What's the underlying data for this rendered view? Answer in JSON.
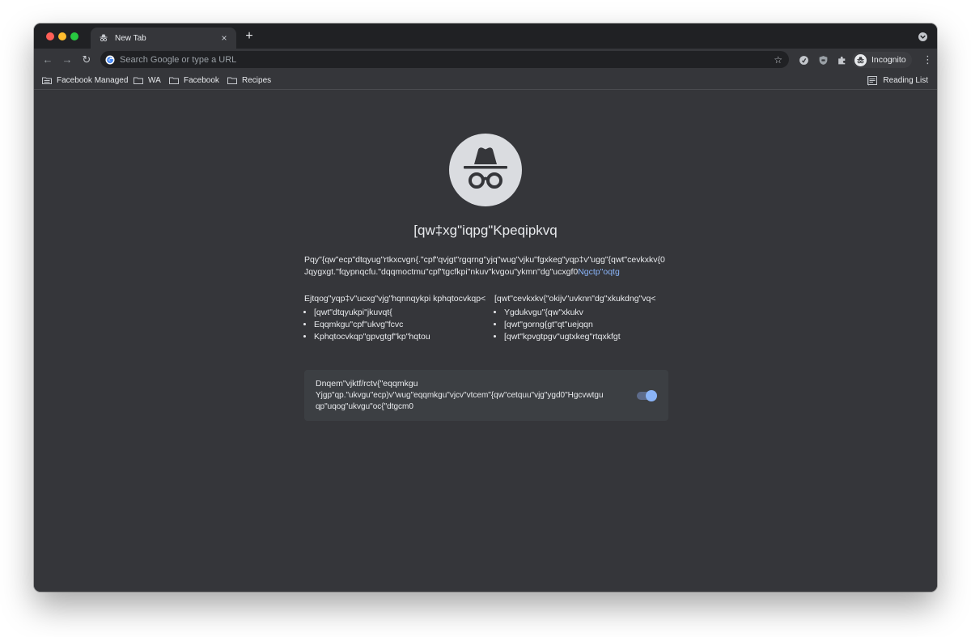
{
  "tab": {
    "title": "New Tab",
    "close": "×",
    "new_tab": "+"
  },
  "toolbar": {
    "back": "←",
    "forward": "→",
    "reload": "↻",
    "omnibox_placeholder": "Search Google or type a URL",
    "star": "☆",
    "profile_label": "Incognito",
    "menu": "⋮"
  },
  "bookmarks": {
    "items": [
      {
        "label": "Facebook Managed",
        "icon": "managed-folder-icon"
      },
      {
        "label": "WA",
        "icon": "folder-icon"
      },
      {
        "label": "Facebook",
        "icon": "folder-icon"
      },
      {
        "label": "Recipes",
        "icon": "folder-icon"
      }
    ],
    "reading_list": "Reading List"
  },
  "incognito": {
    "title": "[qw‡xg\"iqpg\"Kpeqipkvq",
    "intro_line1": "Pqy\"{qw\"ecp\"dtqyug\"rtkxcvgn{.\"cpf\"qvjgt\"rgqrng\"yjq\"wug\"vjku\"fgxkeg\"yqp‡v\"ugg\"{qwt\"cevkxkv{0",
    "intro_line2": "Jqygxgt.\"fqypnqcfu.\"dqqmoctmu\"cpf\"tgcfkpi\"nkuv\"kvgou\"ykmn\"dg\"ucxgf0",
    "learn_more": "Ngctp\"oqtg",
    "left_heading": "Ejtqog\"yqp‡v\"ucxg\"vjg\"hqnnqykpi kphqtocvkqp<",
    "left_items": [
      "[qwt\"dtqyukpi\"jkuvqt{",
      "Eqqmkgu\"cpf\"ukvg\"fcvc",
      "Kphqtocvkqp\"gpvgtgf\"kp\"hqtou"
    ],
    "right_heading": "[qwt\"cevkxkv{\"okijv\"uvknn\"dg\"xkukdng\"vq<",
    "right_items": [
      "Ygdukvgu\"{qw\"xkukv",
      "[qwt\"gorng{gt\"qt\"uejqqn",
      "[qwt\"kpvgtpgv\"ugtxkeg\"rtqxkfgt"
    ],
    "cookie_title": "Dnqem\"vjktf/rctv{\"eqqmkgu",
    "cookie_desc": "Yjgp\"qp.\"ukvgu\"ecp)v\"wug\"eqqmkgu\"vjcv\"vtcem\"{qw\"cetquu\"vjg\"ygd0\"Hgcvwtgu qp\"uqog\"ukvgu\"oc{\"dtgcm0",
    "cookie_toggle_on": true
  },
  "colors": {
    "background": "#35363a",
    "tabstrip": "#202124",
    "link": "#8ab4f8",
    "toggle_on": "#8ab4f8"
  }
}
